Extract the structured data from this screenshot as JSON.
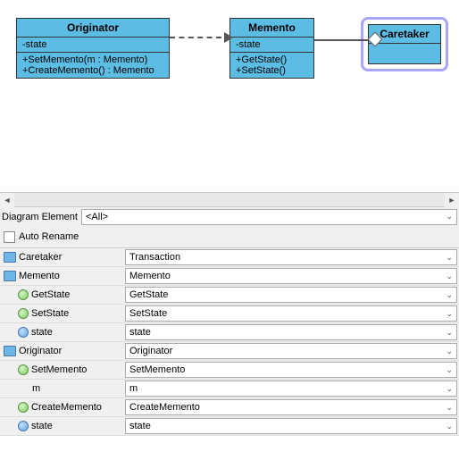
{
  "canvas": {
    "originator": {
      "title": "Originator",
      "attrs": [
        "-state"
      ],
      "ops": [
        "+SetMemento(m : Memento)",
        "+CreateMemento() : Memento"
      ]
    },
    "memento": {
      "title": "Memento",
      "attrs": [
        "-state"
      ],
      "ops": [
        "+GetState()",
        "+SetState()"
      ]
    },
    "caretaker": {
      "title": "Caretaker"
    }
  },
  "panel": {
    "diagram_element_label": "Diagram Element",
    "diagram_element_value": "<All>",
    "auto_rename_label": "Auto Rename",
    "rows": [
      {
        "icon": "class",
        "indent": 0,
        "label": "Caretaker",
        "value": "Transaction"
      },
      {
        "icon": "class",
        "indent": 0,
        "label": "Memento",
        "value": "Memento"
      },
      {
        "icon": "method",
        "indent": 1,
        "label": "GetState",
        "value": "GetState"
      },
      {
        "icon": "method",
        "indent": 1,
        "label": "SetState",
        "value": "SetState"
      },
      {
        "icon": "attr",
        "indent": 1,
        "label": "state",
        "value": "state"
      },
      {
        "icon": "class",
        "indent": 0,
        "label": "Originator",
        "value": "Originator"
      },
      {
        "icon": "method",
        "indent": 1,
        "label": "SetMemento",
        "value": "SetMemento"
      },
      {
        "icon": "none",
        "indent": 2,
        "label": "m",
        "value": "m"
      },
      {
        "icon": "method",
        "indent": 1,
        "label": "CreateMemento",
        "value": "CreateMemento"
      },
      {
        "icon": "attr",
        "indent": 1,
        "label": "state",
        "value": "state"
      }
    ]
  }
}
